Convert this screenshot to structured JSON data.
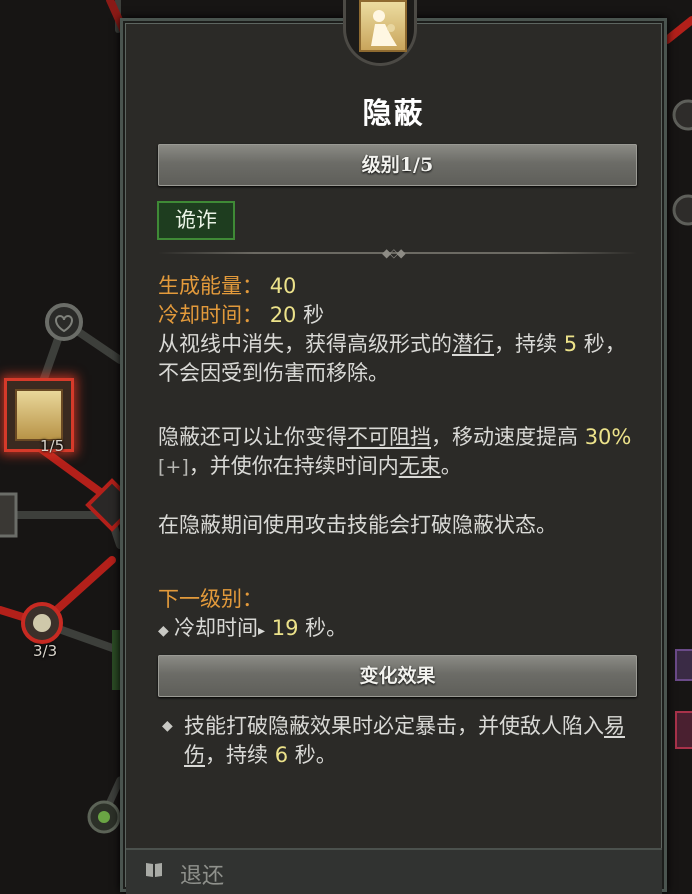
{
  "tree": {
    "node_level": "1/5",
    "passive_level": "3/3"
  },
  "tooltip": {
    "title": "隐蔽",
    "rank": "级别1/5",
    "tag": "诡诈",
    "stats": {
      "energy_label": "生成能量：",
      "energy_value": "40",
      "cooldown_label": "冷却时间：",
      "cooldown_value": "20",
      "seconds_unit": "秒"
    },
    "desc1": {
      "a": "从视线中消失，获得高级形式的",
      "keyword": "潜行",
      "b": "，持续",
      "num": "5",
      "c": "秒，不会因受到伤害而移除。"
    },
    "desc2": {
      "a": "隐蔽还可以让你变得",
      "keyword1": "不可阻挡",
      "b": "，移动速度提高",
      "num": "30%",
      "plus": "[+]",
      "c": "，并使你在持续时间内",
      "keyword2": "无束",
      "d": "。"
    },
    "desc3": "在隐蔽期间使用攻击技能会打破隐蔽状态。",
    "next_rank": {
      "label": "下一级别：",
      "item_label": "冷却时间",
      "arrow": "▸",
      "value": "19",
      "unit": "秒。"
    },
    "modifier_header": "变化效果",
    "modifier": {
      "a": "技能打破隐蔽效果时必定暴击，并使敌人陷入",
      "keyword": "易伤",
      "b": "，持续",
      "num": "6",
      "c": "秒。"
    }
  },
  "bottom": {
    "back_label": "退还"
  },
  "colors": {
    "panel_bg": "#2b2a27",
    "stat_label": "#e39a3b",
    "number": "#ece28a",
    "tag_bg": "#1e3d1f",
    "tag_border": "#3f8a36",
    "tree_active_line": "#b3201a"
  }
}
